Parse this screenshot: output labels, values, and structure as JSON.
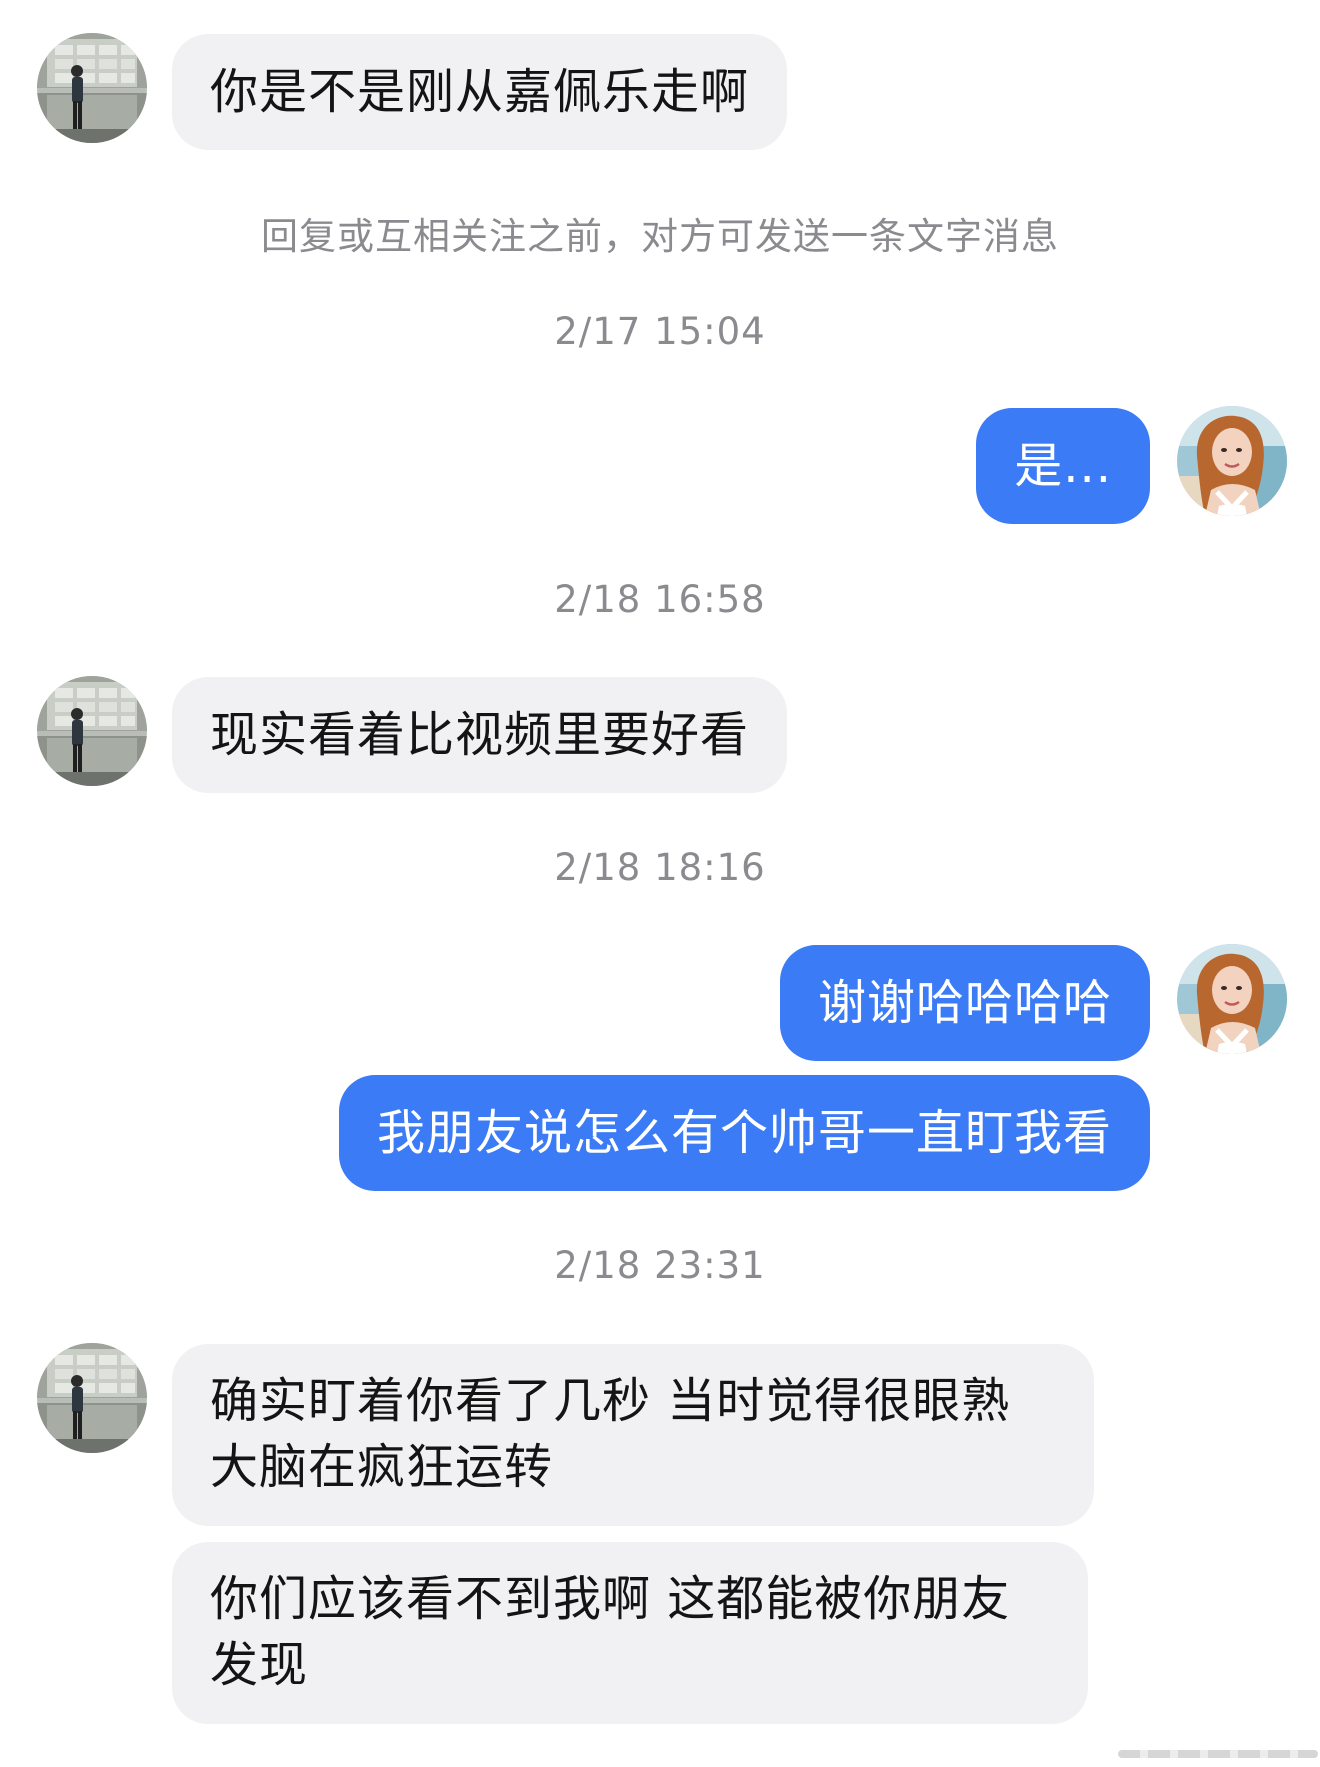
{
  "conversation": {
    "messages": [
      {
        "from": "other",
        "text": "你是不是刚从嘉佩乐走啊"
      },
      {
        "from": "me",
        "text": "是..."
      },
      {
        "from": "other",
        "text": "现实看着比视频里要好看"
      },
      {
        "from": "me",
        "text": "谢谢哈哈哈哈"
      },
      {
        "from": "me",
        "text": "我朋友说怎么有个帅哥一直盯我看"
      },
      {
        "from": "other",
        "lines": [
          "确实盯着你看了几秒 当时觉得很眼熟",
          "大脑在疯狂运转"
        ]
      },
      {
        "from": "other",
        "lines": [
          "你们应该看不到我啊 这都能被你朋友",
          "发现"
        ]
      }
    ],
    "system_notice": "回复或互相关注之前，对方可发送一条文字消息",
    "timestamps": [
      "2/17 15:04",
      "2/18 16:58",
      "2/18 18:16",
      "2/18 23:31"
    ]
  },
  "theme": {
    "outgoing_bubble": "#3b7bf5",
    "incoming_bubble": "#f1f1f3",
    "meta_text": "#8a8a8f"
  },
  "icons": {
    "other_avatar": "photo-of-person-standing-avatar",
    "my_avatar": "photo-of-woman-at-beach-avatar"
  }
}
